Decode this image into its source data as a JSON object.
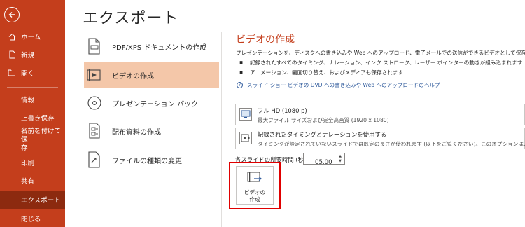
{
  "sidebar": {
    "back_label": "",
    "items": [
      {
        "label": "ホーム",
        "icon": "home-icon"
      },
      {
        "label": "新規",
        "icon": "new-document-icon"
      },
      {
        "label": "開く",
        "icon": "open-folder-icon"
      },
      {
        "label": "情報"
      },
      {
        "label": "上書き保存"
      },
      {
        "label": "名前を付けて保\n存"
      },
      {
        "label": "印刷"
      },
      {
        "label": "共有"
      },
      {
        "label": "エクスポート"
      },
      {
        "label": "閉じる"
      }
    ],
    "bg_color": "#c43e1c",
    "selected_color": "#8c2a0f"
  },
  "page": {
    "title": "エクスポート"
  },
  "export_options": [
    {
      "label": "PDF/XPS ドキュメントの作成",
      "icon": "pdf-document-icon"
    },
    {
      "label": "ビデオの作成",
      "icon": "video-icon",
      "selected": true
    },
    {
      "label": "プレゼンテーション パック",
      "icon": "cd-package-icon"
    },
    {
      "label": "配布資料の作成",
      "icon": "handouts-icon"
    },
    {
      "label": "ファイルの種類の変更",
      "icon": "change-file-type-icon"
    }
  ],
  "right_panel": {
    "title": "ビデオの作成",
    "description": "プレゼンテーションを、ディスクへの書き込みや Web へのアップロード、電子メールでの送信ができるビデオとして保存します。",
    "bullets": [
      "記録されたすべてのタイミング、ナレーション、インク ストローク、レーザー ポインターの動きが組み込まれます",
      "アニメーション、画面切り替え、およびメディアも保存されます"
    ],
    "help_link": "スライド ショー ビデオの DVD への書き込みや Web へのアップロードのヘルプ",
    "quality_dropdown": {
      "title": "フル HD (1080 p)",
      "subtitle": "最大ファイル サイズおよび完全高画質 (1920 x 1080)"
    },
    "timing_dropdown": {
      "title": "記録されたタイミングとナレーションを使用する",
      "subtitle": "タイミングが設定されていないスライドでは既定の長さが使われます (以下をご覧ください)。このオプションは、インク"
    },
    "duration_label": "各スライドの所要時間 (秒):",
    "duration_value": "05.00",
    "create_button": "ビデオの\n作成",
    "accent_color": "#c43e1c",
    "highlight_color": "#e00000"
  }
}
